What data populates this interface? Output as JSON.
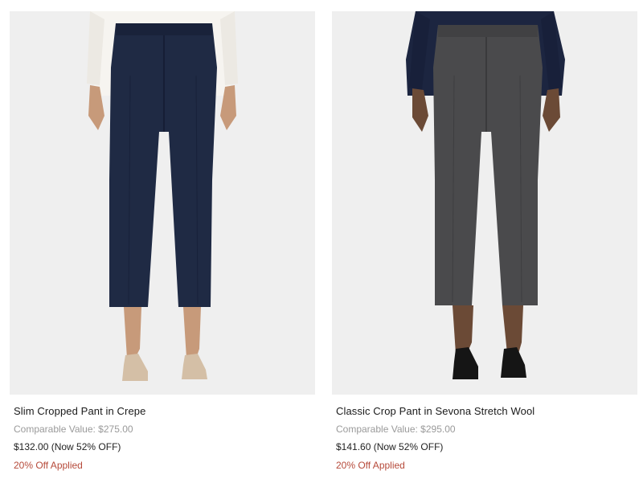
{
  "products": [
    {
      "name": "Slim Cropped Pant in Crepe",
      "comparable": "Comparable Value: $275.00",
      "price": "$132.00 (Now 52% OFF)",
      "promo": "20% Off Applied",
      "pant_color": "#1f2a44",
      "top_color": "#f6f4f0",
      "shoe_color": "#d4bfa6",
      "image_icon": "navy-crop-pant-photo"
    },
    {
      "name": "Classic Crop Pant in Sevona Stretch Wool",
      "comparable": "Comparable Value: $295.00",
      "price": "$141.60 (Now 52% OFF)",
      "promo": "20% Off Applied",
      "pant_color": "#4a4a4c",
      "top_color": "#1c2540",
      "shoe_color": "#151515",
      "image_icon": "grey-crop-pant-photo"
    }
  ],
  "colors": {
    "background": "#ffffff",
    "photo_bg": "#efefef",
    "promo": "#b64a3a",
    "muted": "#9a9a9a"
  }
}
